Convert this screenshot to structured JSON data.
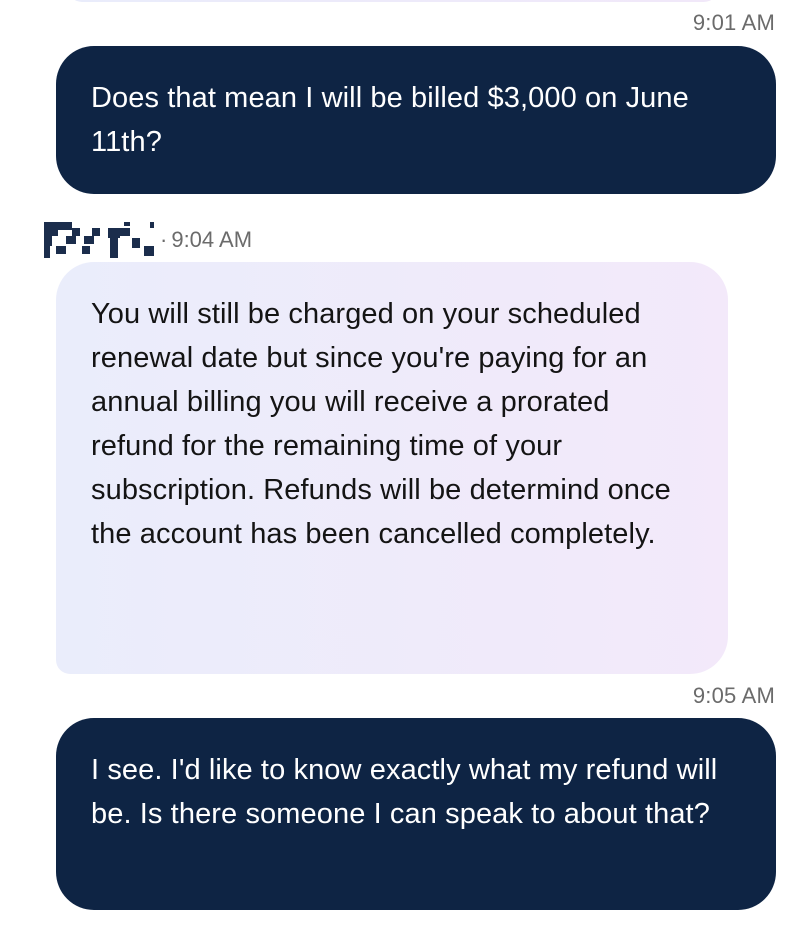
{
  "messages": [
    {
      "role": "user",
      "time": "9:01 AM",
      "text": "Does that mean I will be billed $3,000 on June 11th?"
    },
    {
      "role": "agent",
      "time": "9:04 AM",
      "separator": "·",
      "text": "You will still be charged on your scheduled renewal date but since you're paying for an annual billing you will receive a prorated refund for the remaining time of your subscription. Refunds will be determind once the account has been cancelled completely."
    },
    {
      "role": "user",
      "time": "9:05 AM",
      "text": "I see. I'd like to know exactly what my refund will be. Is there someone I can speak to about that?"
    }
  ],
  "colors": {
    "user_bubble": "#0e2444",
    "agent_bubble_start": "#eaedfb",
    "agent_bubble_end": "#f3e9fa",
    "timestamp": "#6b6b6b"
  }
}
